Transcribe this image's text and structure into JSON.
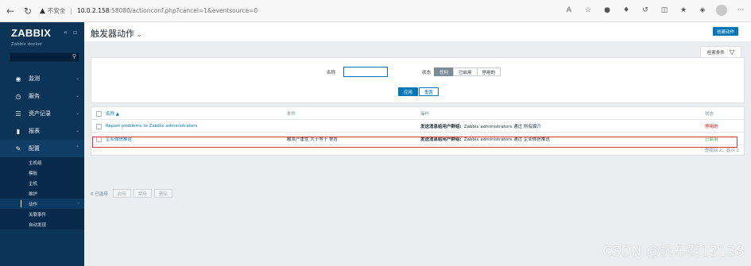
{
  "browser": {
    "insecure_label": "不安全",
    "url_host": "10.0.2.158",
    "url_rest": ":58080/actionconf.php?cancel=1&eventsource=0"
  },
  "sidebar": {
    "brand": "ZABBIX",
    "subtitle": "Zabbix docker",
    "items": [
      {
        "label": "监测",
        "icon": "eye-icon"
      },
      {
        "label": "服务",
        "icon": "clock-icon"
      },
      {
        "label": "资产记录",
        "icon": "list-icon"
      },
      {
        "label": "报表",
        "icon": "bar-chart-icon"
      },
      {
        "label": "配置",
        "icon": "wrench-icon"
      }
    ],
    "submenu": [
      "主机组",
      "模板",
      "主机",
      "维护",
      "动作",
      "关联事件",
      "自动发现"
    ]
  },
  "header": {
    "title": "触发器动作",
    "create_button": "创建动作"
  },
  "filter": {
    "tab_label": "检索条件",
    "name_label": "名称",
    "name_value": "",
    "status_label": "状态",
    "status_options": [
      "任何",
      "已启用",
      "停用的"
    ],
    "apply": "应用",
    "reset": "重置"
  },
  "table": {
    "columns": [
      "名称 ▲",
      "条件",
      "操作",
      "状态"
    ],
    "rows": [
      {
        "name": "Report problems to Zabbix administrators",
        "condition": "",
        "op_label": "发送消息给用户群组:",
        "op_text": "Zabbix administrators 通过 所有媒介",
        "status": "停用的",
        "status_color": "#dc0000"
      },
      {
        "name": "企业微信推送",
        "condition": "触发严重性 大于等于 警告",
        "op_label": "发送消息给用户群组:",
        "op_text": "Zabbix administrators 通过 企业微信推送",
        "status": "已启用",
        "status_color": "#429e47"
      }
    ],
    "footer": "查找到 2，显示 2"
  },
  "mass_actions": {
    "selected": "0 已选择",
    "buttons": [
      "启用",
      "禁用",
      "删除"
    ]
  },
  "watermark": "CSDN @帆布鞋12138",
  "colors": {
    "sidebar_bg": "#0c3456",
    "accent": "#0275b8",
    "highlight": "#e03333"
  }
}
